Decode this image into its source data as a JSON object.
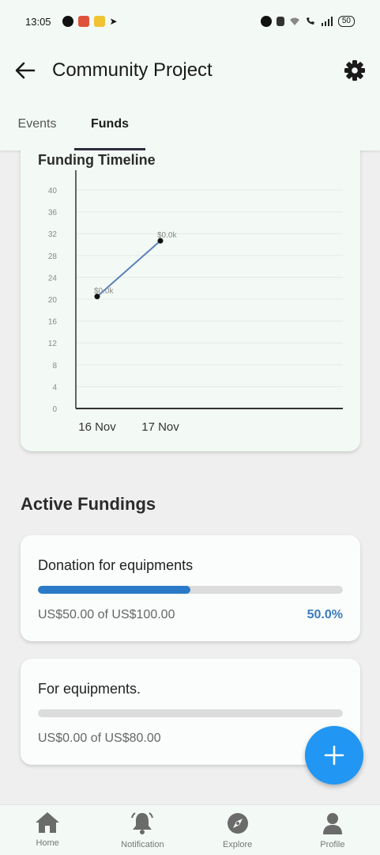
{
  "status_bar": {
    "time": "13:05",
    "battery": "50"
  },
  "app_bar": {
    "title": "Community Project"
  },
  "tabs": [
    {
      "label": "Events",
      "active": false
    },
    {
      "label": "Funds",
      "active": true
    }
  ],
  "timeline": {
    "title": "Funding Timeline"
  },
  "chart_data": {
    "type": "line",
    "title": "Funding Timeline",
    "categories": [
      "16 Nov",
      "17 Nov"
    ],
    "series": [
      {
        "values": [
          20.5,
          30.7
        ],
        "point_labels": [
          "$0.0k",
          "$0.0k"
        ],
        "color": "#5b7fb8"
      }
    ],
    "yticks": [
      "0",
      "4",
      "8",
      "12",
      "16",
      "20",
      "24",
      "28",
      "32",
      "36",
      "40"
    ],
    "ylim": [
      0,
      40
    ],
    "grid": true
  },
  "active_fundings": {
    "title": "Active Fundings",
    "items": [
      {
        "name": "Donation for equipments",
        "amount_text": "US$50.00 of US$100.00",
        "percent_text": "50.0%",
        "progress": 0.5
      },
      {
        "name": "For equipments.",
        "amount_text": "US$0.00 of US$80.00",
        "percent_text": "",
        "progress": 0.0
      }
    ]
  },
  "bottom_nav": [
    {
      "label": "Home",
      "icon": "home-icon"
    },
    {
      "label": "Notification",
      "icon": "bell-icon"
    },
    {
      "label": "Explore",
      "icon": "compass-icon"
    },
    {
      "label": "Profile",
      "icon": "person-icon"
    }
  ],
  "colors": {
    "accent": "#2196f3",
    "progress": "#2a7ac8",
    "percent": "#3a7bbf",
    "header_bg": "#f3faf5"
  }
}
